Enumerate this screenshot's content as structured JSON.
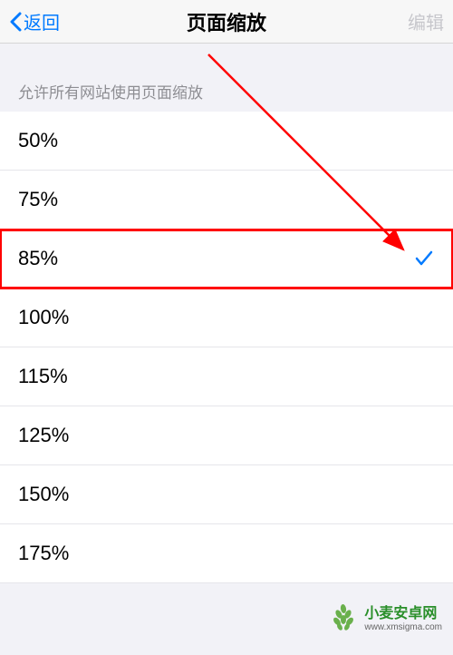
{
  "navbar": {
    "back_label": "返回",
    "title": "页面缩放",
    "edit_label": "编辑"
  },
  "section_header": "允许所有网站使用页面缩放",
  "zoom_options": [
    {
      "label": "50%",
      "selected": false,
      "highlighted": false
    },
    {
      "label": "75%",
      "selected": false,
      "highlighted": false
    },
    {
      "label": "85%",
      "selected": true,
      "highlighted": true
    },
    {
      "label": "100%",
      "selected": false,
      "highlighted": false
    },
    {
      "label": "115%",
      "selected": false,
      "highlighted": false
    },
    {
      "label": "125%",
      "selected": false,
      "highlighted": false
    },
    {
      "label": "150%",
      "selected": false,
      "highlighted": false
    },
    {
      "label": "175%",
      "selected": false,
      "highlighted": false
    }
  ],
  "watermark": {
    "name": "小麦安卓网",
    "url": "www.xmsigma.com"
  }
}
